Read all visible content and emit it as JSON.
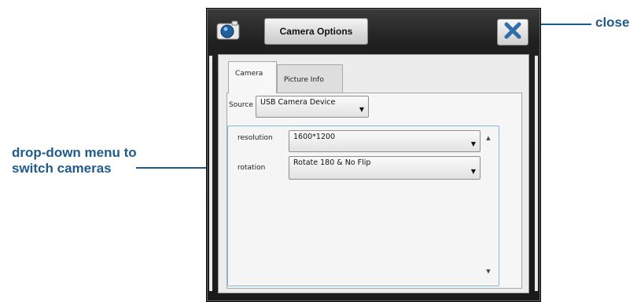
{
  "callouts": {
    "close": "close",
    "dropdown_line1": "drop-down menu to",
    "dropdown_line2": "switch cameras"
  },
  "window": {
    "title": "Camera Options",
    "icons": {
      "app": "camera-icon",
      "close": "close-icon"
    }
  },
  "tabs": [
    {
      "label": "Camera",
      "selected": true
    },
    {
      "label": "Picture Info",
      "selected": false
    }
  ],
  "source": {
    "label": "Source",
    "value": "USB Camera Device"
  },
  "settings": {
    "resolution": {
      "label": "resolution",
      "value": "1600*1200"
    },
    "rotation": {
      "label": "rotation",
      "value": "Rotate 180 & No Flip"
    }
  },
  "colors": {
    "callout": "#1f5b8c",
    "window_frame": "#1f1f1f",
    "accent_border": "#86b8d8",
    "close_x": "#2f6ea8"
  }
}
